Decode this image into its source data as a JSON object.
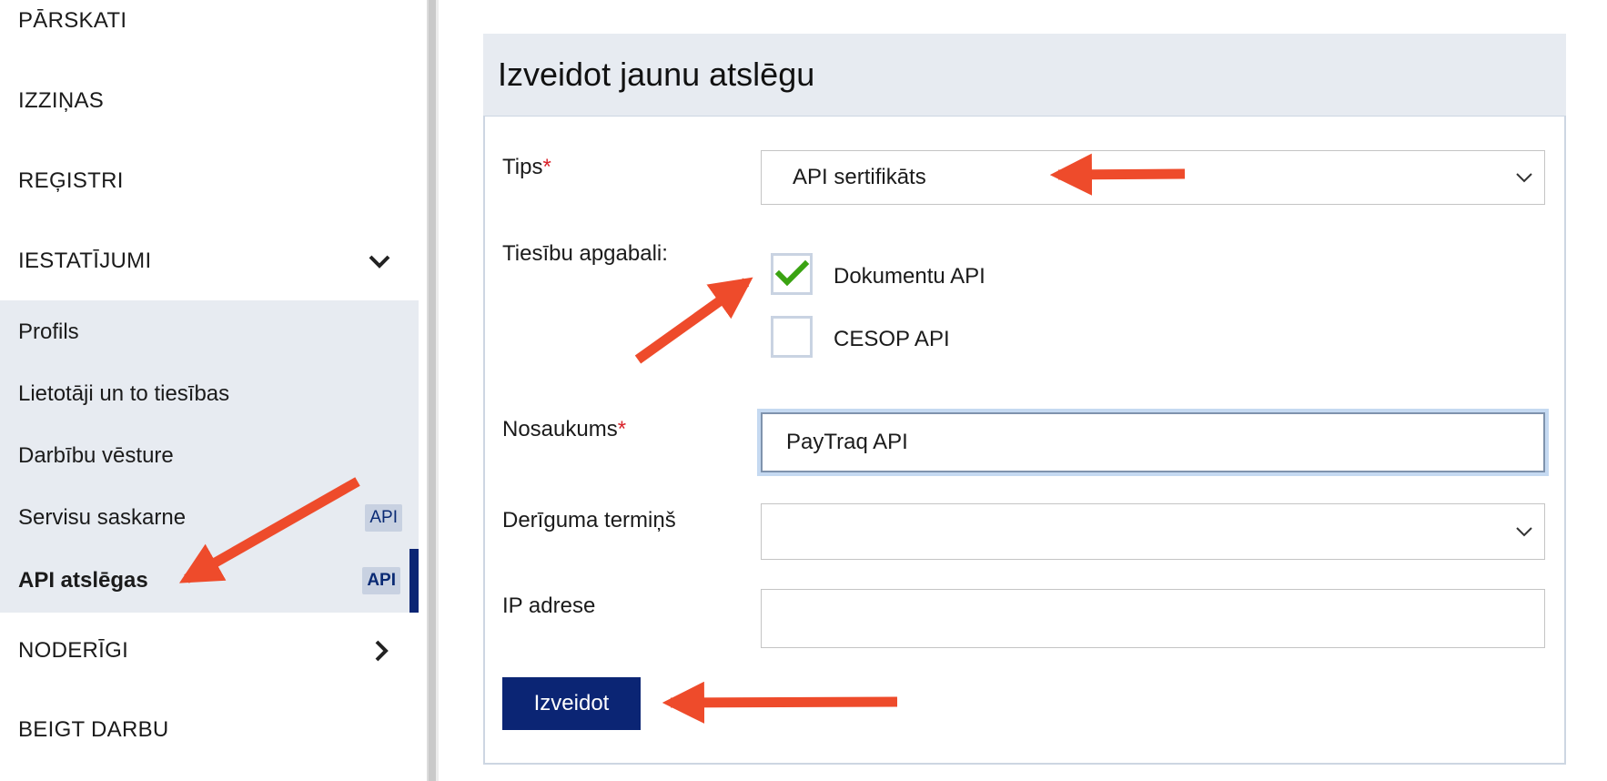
{
  "sidebar": {
    "items": [
      {
        "label": "PĀRSKATI"
      },
      {
        "label": "IZZIŅAS"
      },
      {
        "label": "REĢISTRI"
      },
      {
        "label": "IESTATĪJUMI"
      }
    ],
    "submenu": [
      {
        "label": "Profils"
      },
      {
        "label": "Lietotāji un to tiesības"
      },
      {
        "label": "Darbību vēsture"
      },
      {
        "label": "Servisu saskarne",
        "badge": "API"
      },
      {
        "label": "API atslēgas",
        "badge": "API",
        "active": true
      }
    ],
    "after": [
      {
        "label": "NODERĪGI"
      },
      {
        "label": "BEIGT DARBU"
      }
    ]
  },
  "form": {
    "title": "Izveidot jaunu atslēgu",
    "type_label": "Tips",
    "type_value": "API sertifikāts",
    "scopes_label": "Tiesību apgabali:",
    "scopes": [
      {
        "label": "Dokumentu API",
        "checked": true
      },
      {
        "label": "CESOP API",
        "checked": false
      }
    ],
    "name_label": "Nosaukums",
    "name_value": "PayTraq API",
    "validity_label": "Derīguma termiņš",
    "validity_value": "",
    "ip_label": "IP adrese",
    "ip_value": "",
    "required_mark": "*",
    "submit_label": "Izveidot"
  },
  "colors": {
    "accent": "#0b2574",
    "submenu_bg": "#e7ebf1",
    "annotation_arrow": "#ee4b2b",
    "checkmark": "#3aa312",
    "required": "#d9222a"
  }
}
